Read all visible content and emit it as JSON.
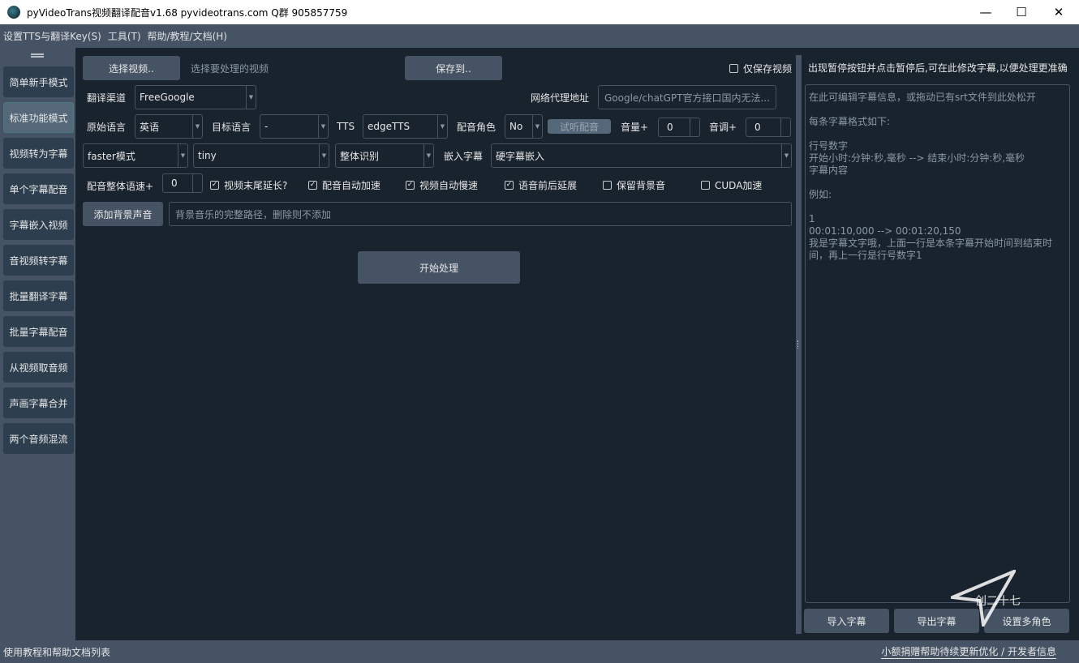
{
  "window": {
    "title": "pyVideoTrans视频翻译配音v1.68 pyvideotrans.com  Q群 905857759",
    "minimize": "—",
    "maximize": "☐",
    "close": "✕"
  },
  "menu": [
    "设置TTS与翻译Key(S)",
    "工具(T)",
    "帮助/教程/文档(H)"
  ],
  "sidebar": {
    "items": [
      "简单新手模式",
      "标准功能模式",
      "视频转为字幕",
      "单个字幕配音",
      "字幕嵌入视频",
      "音视频转字幕",
      "批量翻译字幕",
      "批量字幕配音",
      "从视频取音频",
      "声画字幕合并",
      "两个音频混流"
    ],
    "active_index": 1
  },
  "main": {
    "select_video_button": "选择视频..",
    "select_video_hint": "选择要处理的视频",
    "save_to_button": "保存到..",
    "only_save_video": "仅保存视频",
    "translate_channel_label": "翻译渠道",
    "translate_channel_value": "FreeGoogle",
    "proxy_label": "网络代理地址",
    "proxy_placeholder": "Google/chatGPT官方接口国内无法...",
    "source_lang_label": "原始语言",
    "source_lang_value": "英语",
    "target_lang_label": "目标语言",
    "target_lang_value": "-",
    "tts_label": "TTS",
    "tts_value": "edgeTTS",
    "voice_role_label": "配音角色",
    "voice_role_value": "No",
    "listen_button": "试听配音",
    "volume_label": "音量+",
    "volume_value": "0",
    "pitch_label": "音调+",
    "pitch_value": "0",
    "model_mode_value": "faster模式",
    "model_value": "tiny",
    "recognize_value": "整体识别",
    "embed_sub_label": "嵌入字幕",
    "embed_sub_value": "硬字幕嵌入",
    "speed_label": "配音整体语速+",
    "speed_value": "0",
    "chk_video_extend": "视频末尾延长?",
    "chk_voice_autorate": "配音自动加速",
    "chk_video_autorate": "视频自动慢速",
    "chk_voice_pad": "语音前后延展",
    "chk_keep_bg": "保留背景音",
    "chk_cuda": "CUDA加速",
    "add_bg_button": "添加背景声音",
    "bg_placeholder": "背景音乐的完整路径，删除则不添加",
    "start_button": "开始处理"
  },
  "right": {
    "header": "出现暂停按钮并点击暂停后,可在此修改字幕,以便处理更准确",
    "editor_lines": [
      "在此可编辑字幕信息，或拖动已有srt文件到此处松开",
      "",
      "每条字幕格式如下:",
      "",
      "行号数字",
      "开始小时:分钟:秒,毫秒 --> 结束小时:分钟:秒,毫秒",
      "字幕内容",
      "",
      "例如:",
      "",
      "1",
      "00:01:10,000 --> 00:01:20,150",
      "我是字幕文字哦，上面一行是本条字幕开始时间到结束时",
      "间，再上一行是行号数字1"
    ],
    "import_button": "导入字幕",
    "export_button": "导出字幕",
    "multi_role_button": "设置多角色"
  },
  "status": {
    "left": "使用教程和帮助文档列表",
    "right": "小额捐赠帮助待续更新优化 / 开发者信息"
  },
  "watermark": "创二十七"
}
